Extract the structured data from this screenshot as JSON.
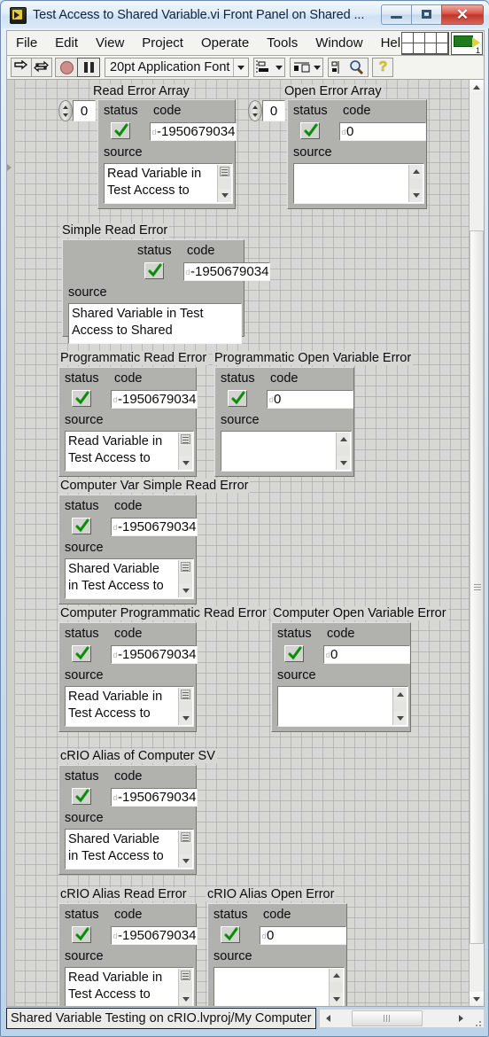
{
  "window": {
    "title": "Test Access to Shared Variable.vi Front Panel on Shared ...",
    "icon": "labview-vi-icon",
    "buttons": {
      "minimize": "minimize-icon",
      "maximize": "maximize-icon",
      "close": "close-icon"
    }
  },
  "menubar": {
    "items": [
      "File",
      "Edit",
      "View",
      "Project",
      "Operate",
      "Tools",
      "Window",
      "Help"
    ],
    "connector_pane_icon": "connector-pane-icon",
    "vi_icon": "vi-terminal-icon",
    "vi_icon_number": "1"
  },
  "toolbar": {
    "run_icon": "run-arrow-icon",
    "run_continuous_icon": "run-continuously-icon",
    "abort_icon": "abort-execution-icon",
    "pause_icon": "pause-icon",
    "font_label": "20pt Application Font",
    "font_caret_icon": "chevron-down-icon",
    "align_icon": "align-objects-icon",
    "distribute_icon": "distribute-objects-icon",
    "resize_icon": "resize-objects-icon",
    "reorder_icon": "reorder-icon",
    "search_icon": "search-icon",
    "help_icon": "context-help-icon"
  },
  "panel": {
    "scrollbar": {
      "up_icon": "scroll-up-icon",
      "down_icon": "scroll-down-icon",
      "grip_icon": "scroll-grip-icon"
    },
    "cluster_fields": {
      "status": "status",
      "code": "code",
      "source": "source"
    },
    "status_true_icon": "green-check-icon",
    "sections": [
      {
        "name": "read-error-array",
        "label": "Read Error Array",
        "index_value": "0",
        "code": "-1950679034",
        "source": "Read Variable in\nTest Access to",
        "has_index": true,
        "source_scroll": true
      },
      {
        "name": "open-error-array",
        "label": "Open Error Array",
        "index_value": "0",
        "code": "0",
        "source": "",
        "has_index": true,
        "source_scroll": true
      },
      {
        "name": "simple-read-error",
        "label": "Simple Read Error",
        "code": "-1950679034",
        "source": "Shared Variable in Test\nAccess to Shared",
        "has_index": false,
        "source_scroll": false
      },
      {
        "name": "programmatic-read-error",
        "label": "Programmatic Read Error",
        "code": "-1950679034",
        "source": "Read Variable in\nTest Access to",
        "has_index": false,
        "source_scroll": true
      },
      {
        "name": "programmatic-open-variable-error",
        "label": "Programmatic Open Variable Error",
        "code": "0",
        "source": "",
        "has_index": false,
        "source_scroll": true
      },
      {
        "name": "computer-var-simple-read-error",
        "label": "Computer Var Simple Read Error",
        "code": "-1950679034",
        "source": "Shared Variable\nin Test Access to",
        "has_index": false,
        "source_scroll": true
      },
      {
        "name": "computer-programmatic-read-error",
        "label": "Computer Programmatic Read Error",
        "code": "-1950679034",
        "source": "Read Variable in\nTest Access to",
        "has_index": false,
        "source_scroll": true
      },
      {
        "name": "computer-open-variable-error",
        "label": "Computer Open Variable Error",
        "code": "0",
        "source": "",
        "has_index": false,
        "source_scroll": true
      },
      {
        "name": "crio-alias-of-computer-sv",
        "label": "cRIO Alias of Computer SV",
        "code": "-1950679034",
        "source": "Shared Variable\nin Test Access to",
        "has_index": false,
        "source_scroll": true
      },
      {
        "name": "crio-alias-read-error",
        "label": "cRIO Alias Read Error",
        "code": "-1950679034",
        "source": "Read Variable in\nTest Access to",
        "has_index": false,
        "source_scroll": true
      },
      {
        "name": "crio-alias-open-error",
        "label": "cRIO Alias Open Error",
        "code": "0",
        "source": "",
        "has_index": false,
        "source_scroll": true
      }
    ]
  },
  "statusbar": {
    "text": "Shared Variable Testing on cRIO.lvproj/My Computer",
    "left_arrow_icon": "scroll-left-icon",
    "right_arrow_icon": "scroll-right-icon",
    "thumb_grip_icon": "scroll-grip-icon",
    "resize_grip_icon": "resize-grip-icon"
  },
  "colors": {
    "panel_bg": "#d7d7d4",
    "cluster_bg": "#b1b1ae",
    "status_ok": "#2aa02a",
    "title_bar": "#dfecf8",
    "close_button": "#c03327"
  }
}
